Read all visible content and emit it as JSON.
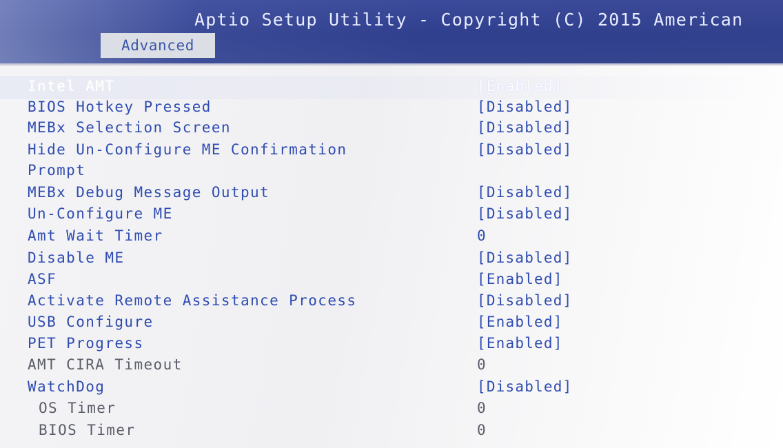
{
  "header": {
    "title": "Aptio Setup Utility - Copyright (C) 2015 American",
    "tab_active": "Advanced"
  },
  "settings": [
    {
      "label": "Intel AMT",
      "value": "[Enabled]"
    },
    {
      "label": "BIOS Hotkey Pressed",
      "value": "[Disabled]"
    },
    {
      "label": "MEBx Selection Screen",
      "value": "[Disabled]"
    },
    {
      "label": "Hide Un-Configure ME Confirmation",
      "value": "[Disabled]"
    },
    {
      "label": "Prompt",
      "value": ""
    },
    {
      "label": "MEBx Debug Message Output",
      "value": "[Disabled]"
    },
    {
      "label": "Un-Configure ME",
      "value": "[Disabled]"
    },
    {
      "label": "Amt Wait Timer",
      "value": "0"
    },
    {
      "label": "Disable ME",
      "value": "[Disabled]"
    },
    {
      "label": "ASF",
      "value": "[Enabled]"
    },
    {
      "label": "Activate Remote Assistance Process",
      "value": "[Disabled]"
    },
    {
      "label": "USB Configure",
      "value": "[Enabled]"
    },
    {
      "label": "PET Progress",
      "value": "[Enabled]"
    },
    {
      "label": "AMT CIRA Timeout",
      "value": "0"
    },
    {
      "label": "WatchDog",
      "value": "[Disabled]"
    },
    {
      "label": "OS Timer",
      "value": "0"
    },
    {
      "label": "BIOS Timer",
      "value": "0"
    }
  ],
  "colors": {
    "header_bg": "#2f3f8d",
    "option_text": "#2f4cb0",
    "inactive_text": "#5a5d68",
    "selected_text": "#ffffff",
    "tab_bg": "#dcdee6"
  }
}
